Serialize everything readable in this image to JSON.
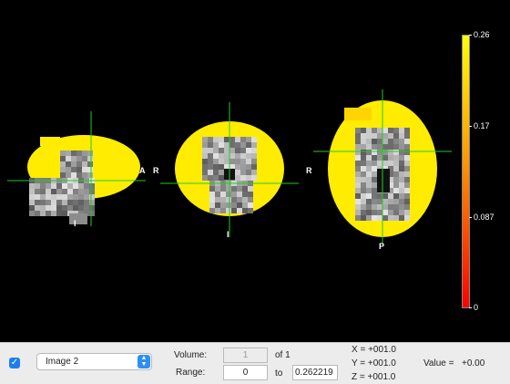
{
  "viewer": {
    "orientation_labels": {
      "sagittal_anterior": "A",
      "sagittal_inferior": "I",
      "coronal_right": "R",
      "coronal_inferior": "I",
      "axial_right": "R",
      "axial_posterior": "P"
    }
  },
  "colorbar": {
    "labels": [
      "0.26",
      "0.17",
      "0.087",
      "0"
    ],
    "colors": [
      "#ffff00",
      "#ff0000"
    ]
  },
  "panel": {
    "checkbox_checked": true,
    "image_select_value": "Image 2",
    "volume_label": "Volume:",
    "volume_value": "1",
    "volume_of": "of 1",
    "range_label": "Range:",
    "range_min": "0",
    "range_to": "to",
    "range_max": "0.262219",
    "coord_x": "X = +001.0",
    "coord_y": "Y = +001.0",
    "coord_z": "Z = +001.0",
    "value_label": "Value =",
    "value": "+0.00"
  },
  "colors": {
    "crosshair": "#22cc22",
    "overlay": "#ffec00",
    "background": "#000000",
    "panel": "#ececec"
  }
}
